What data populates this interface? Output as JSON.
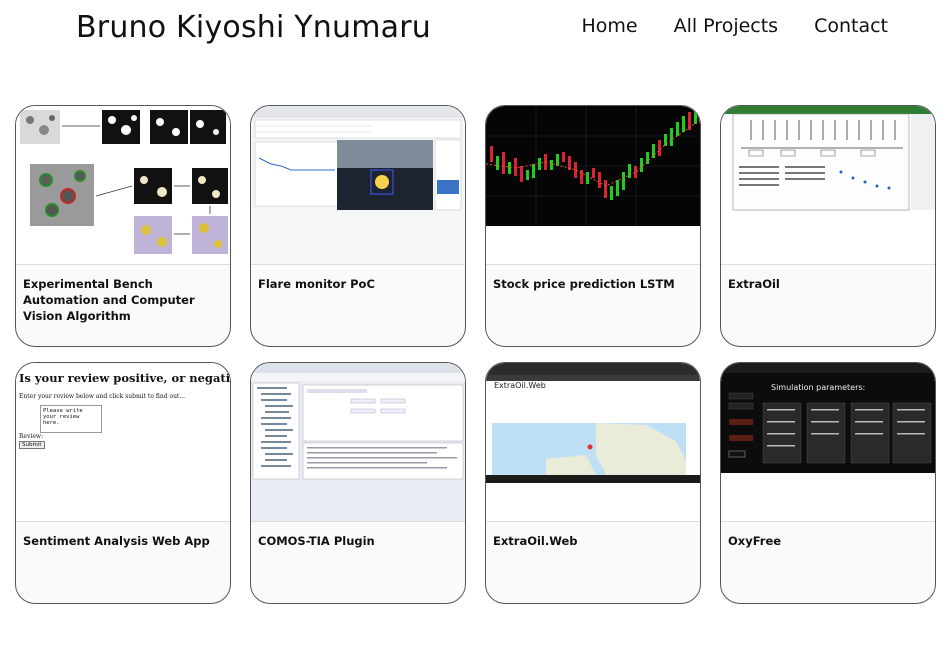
{
  "header": {
    "site_title": "Bruno Kiyoshi Ynumaru",
    "nav": [
      {
        "label": "Home"
      },
      {
        "label": "All Projects"
      },
      {
        "label": "Contact"
      }
    ]
  },
  "projects": [
    {
      "title": "Experimental Bench Automation and Computer Vision Algorithm"
    },
    {
      "title": "Flare monitor PoC"
    },
    {
      "title": "Stock price prediction LSTM"
    },
    {
      "title": "ExtraOil"
    },
    {
      "title": "Sentiment Analysis Web App",
      "thumb": {
        "heading": "Is your review positive, or negative?",
        "instructions": "Enter your review below and click submit to find out...",
        "placeholder": "Please write your review here.",
        "review_label": "Review:",
        "submit": "Submit"
      }
    },
    {
      "title": "COMOS-TIA Plugin"
    },
    {
      "title": "ExtraOil.Web",
      "thumb": {
        "heading": "ExtraOil.Web"
      }
    },
    {
      "title": "OxyFree",
      "thumb": {
        "heading": "Simulation parameters:"
      }
    }
  ]
}
